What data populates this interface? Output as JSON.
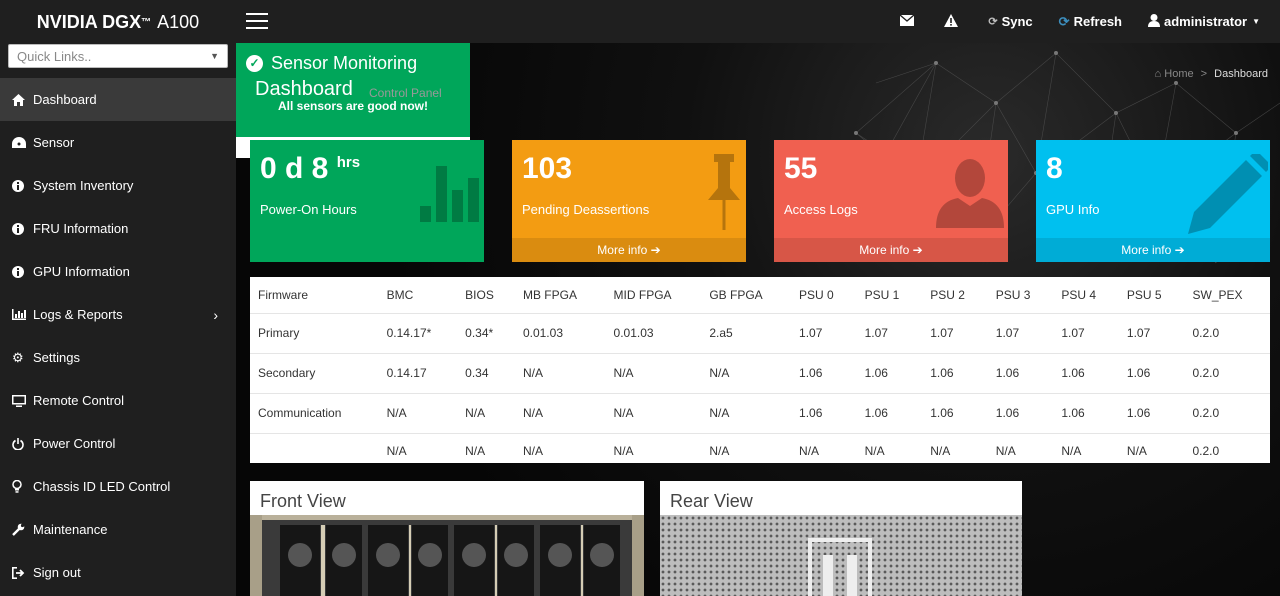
{
  "brand": {
    "name": "NVIDIA DGX",
    "tm": "™",
    "model": "A100"
  },
  "quicklinks": {
    "placeholder": "Quick Links.."
  },
  "nav": {
    "items": [
      {
        "label": "Dashboard",
        "icon": "home-icon"
      },
      {
        "label": "Sensor",
        "icon": "dashboard-gauge-icon"
      },
      {
        "label": "System Inventory",
        "icon": "info-icon"
      },
      {
        "label": "FRU Information",
        "icon": "info-icon"
      },
      {
        "label": "GPU Information",
        "icon": "info-icon"
      },
      {
        "label": "Logs & Reports",
        "icon": "bar-chart-icon"
      },
      {
        "label": "Settings",
        "icon": "gear-icon"
      },
      {
        "label": "Remote Control",
        "icon": "monitor-icon"
      },
      {
        "label": "Power Control",
        "icon": "power-icon"
      },
      {
        "label": "Chassis ID LED Control",
        "icon": "lightbulb-icon"
      },
      {
        "label": "Maintenance",
        "icon": "wrench-icon"
      },
      {
        "label": "Sign out",
        "icon": "sign-out-icon"
      }
    ]
  },
  "topbar": {
    "sync": "Sync",
    "refresh": "Refresh",
    "user": "administrator"
  },
  "page": {
    "title": "Dashboard",
    "subtitle": "Control Panel",
    "breadcrumb_home": "Home",
    "breadcrumb_sep": ">",
    "breadcrumb_current": "Dashboard"
  },
  "boxes": {
    "power": {
      "value": "0 d 8",
      "unit": "hrs",
      "label": "Power-On Hours",
      "color": "#00a65a"
    },
    "pending": {
      "value": "103",
      "label": "Pending Deassertions",
      "more": "More info",
      "color": "#f39c12"
    },
    "logs": {
      "value": "55",
      "label": "Access Logs",
      "more": "More info",
      "color": "#f06050"
    },
    "gpu": {
      "value": "8",
      "label": "GPU Info",
      "more": "More info",
      "color": "#00c0ef"
    }
  },
  "firmware": {
    "headers": [
      "Firmware",
      "BMC",
      "BIOS",
      "MB FPGA",
      "MID FPGA",
      "GB FPGA",
      "PSU 0",
      "PSU 1",
      "PSU 2",
      "PSU 3",
      "PSU 4",
      "PSU 5",
      "SW_PEX"
    ],
    "rows": [
      [
        "Primary",
        "0.14.17*",
        "0.34*",
        "0.01.03",
        "0.01.03",
        "2.a5",
        "1.07",
        "1.07",
        "1.07",
        "1.07",
        "1.07",
        "1.07",
        "0.2.0"
      ],
      [
        "Secondary",
        "0.14.17",
        "0.34",
        "N/A",
        "N/A",
        "N/A",
        "1.06",
        "1.06",
        "1.06",
        "1.06",
        "1.06",
        "1.06",
        "0.2.0"
      ],
      [
        "Communication",
        "N/A",
        "N/A",
        "N/A",
        "N/A",
        "N/A",
        "1.06",
        "1.06",
        "1.06",
        "1.06",
        "1.06",
        "1.06",
        "0.2.0"
      ],
      [
        "",
        "N/A",
        "N/A",
        "N/A",
        "N/A",
        "N/A",
        "N/A",
        "N/A",
        "N/A",
        "N/A",
        "N/A",
        "N/A",
        "0.2.0"
      ]
    ]
  },
  "panels": {
    "front": "Front View",
    "rear": "Rear View",
    "sensor_title": "Sensor Monitoring",
    "sensor_msg": "All sensors are good now!",
    "sensor_color": "#00a65a"
  }
}
